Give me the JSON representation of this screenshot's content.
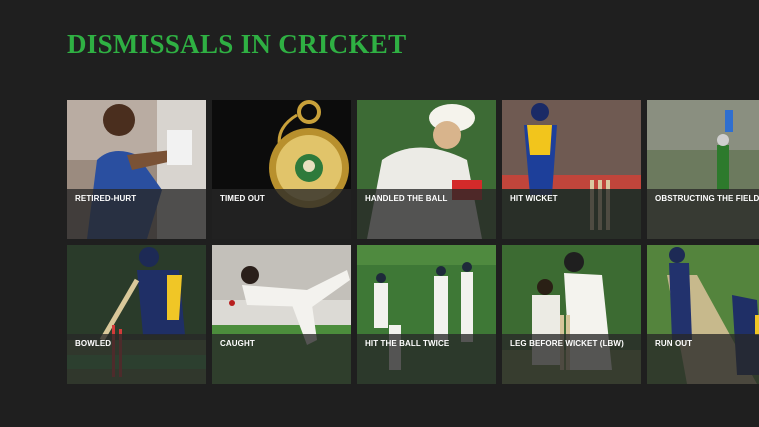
{
  "app": {
    "title": "DISMISSALS IN CRICKET",
    "title_color": "#2fb043",
    "background": "#1f1f1f"
  },
  "tiles": [
    {
      "label": "RETIRED-HURT",
      "icon": "injured-batsman-photo"
    },
    {
      "label": "TIMED OUT",
      "icon": "pocket-watch-photo"
    },
    {
      "label": "HANDLED THE BALL",
      "icon": "batsman-handling-ball-photo"
    },
    {
      "label": "HIT WICKET",
      "icon": "hit-wicket-photo"
    },
    {
      "label": "OBSTRUCTING THE FIELD",
      "icon": "obstructing-field-photo"
    },
    {
      "label": "BOWLED",
      "icon": "bowled-photo"
    },
    {
      "label": "CAUGHT",
      "icon": "diving-catch-photo"
    },
    {
      "label": "HIT THE BALL TWICE",
      "icon": "fielders-photo"
    },
    {
      "label": "LEG BEFORE WICKET (LBW)",
      "icon": "lbw-photo"
    },
    {
      "label": "RUN OUT",
      "icon": "run-out-photo"
    }
  ]
}
